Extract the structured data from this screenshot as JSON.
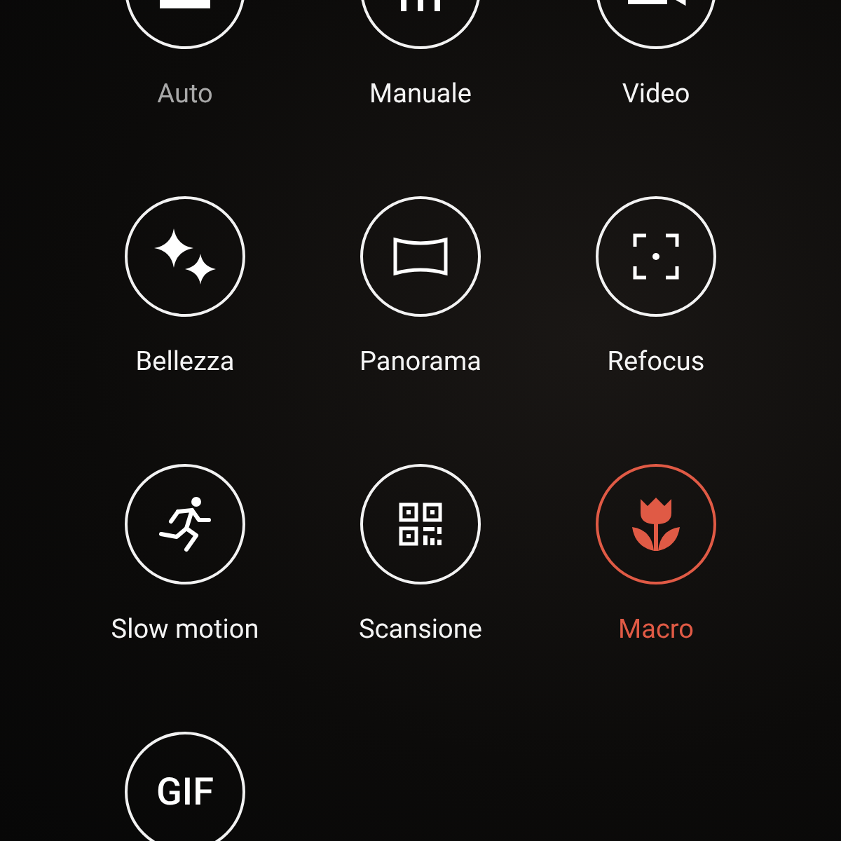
{
  "modes": [
    {
      "kind": "camera",
      "label": "Auto",
      "selected": false,
      "dimmed": true
    },
    {
      "kind": "sliders",
      "label": "Manuale",
      "selected": false,
      "dimmed": false
    },
    {
      "kind": "video",
      "label": "Video",
      "selected": false,
      "dimmed": false
    },
    {
      "kind": "sparkle",
      "label": "Bellezza",
      "selected": false,
      "dimmed": false
    },
    {
      "kind": "panorama",
      "label": "Panorama",
      "selected": false,
      "dimmed": false
    },
    {
      "kind": "focus",
      "label": "Refocus",
      "selected": false,
      "dimmed": false
    },
    {
      "kind": "runner",
      "label": "Slow motion",
      "selected": false,
      "dimmed": false
    },
    {
      "kind": "qr",
      "label": "Scansione",
      "selected": false,
      "dimmed": false
    },
    {
      "kind": "tulip",
      "label": "Macro",
      "selected": true,
      "dimmed": false
    },
    {
      "kind": "text",
      "icon_text": "GIF",
      "selected": false,
      "dimmed": false
    }
  ]
}
